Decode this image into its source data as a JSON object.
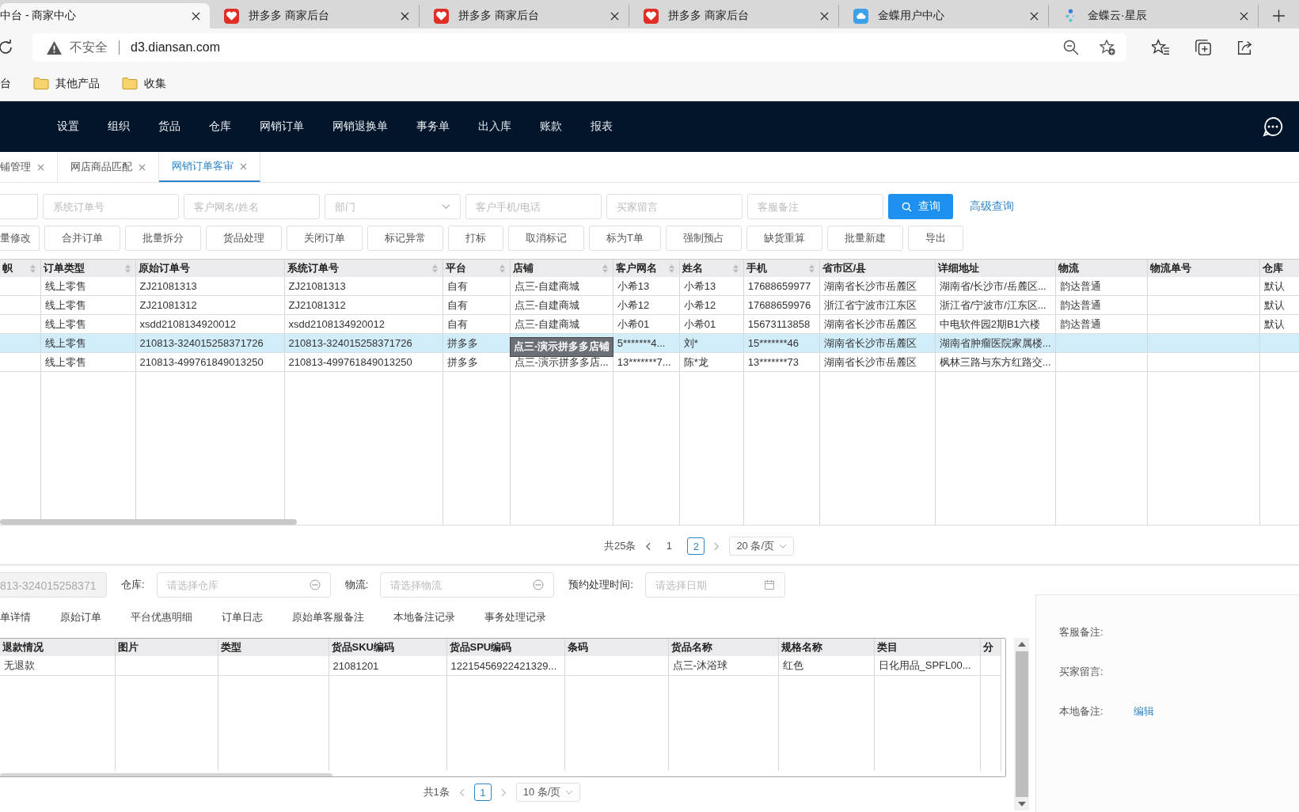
{
  "browser_tabs": [
    {
      "title": "中台 - 商家中心",
      "selected": true,
      "kind": "plain"
    },
    {
      "title": "拼多多 商家后台",
      "selected": false,
      "kind": "shop"
    },
    {
      "title": "拼多多 商家后台",
      "selected": false,
      "kind": "shop"
    },
    {
      "title": "拼多多 商家后台",
      "selected": false,
      "kind": "shop"
    },
    {
      "title": "金蝶用户中心",
      "selected": false,
      "kind": "cloud"
    },
    {
      "title": "金蝶云·星辰",
      "selected": false,
      "kind": "dots"
    }
  ],
  "address": {
    "security": "不安全",
    "url": "d3.diansan.com"
  },
  "bookmarks": [
    {
      "label": "台",
      "kind": "text"
    },
    {
      "label": "其他产品",
      "kind": "folder"
    },
    {
      "label": "收集",
      "kind": "folder"
    }
  ],
  "nav": [
    "设置",
    "组织",
    "货品",
    "仓库",
    "网销订单",
    "网销退换单",
    "事务单",
    "出入库",
    "账款",
    "报表"
  ],
  "page_tabs": [
    {
      "label": "铺管理",
      "selected": false
    },
    {
      "label": "网店商品匹配",
      "selected": false
    },
    {
      "label": "网销订单客审",
      "selected": true
    }
  ],
  "filters": [
    {
      "kind": "text"
    },
    {
      "kind": "text",
      "placeholder": "系统订单号"
    },
    {
      "kind": "text",
      "placeholder": "客户网名/姓名"
    },
    {
      "kind": "select",
      "placeholder": "部门"
    },
    {
      "kind": "text",
      "placeholder": "客户手机/电话"
    },
    {
      "kind": "text",
      "placeholder": "买家留言"
    },
    {
      "kind": "text",
      "placeholder": "客服备注"
    }
  ],
  "search_button": "查询",
  "advanced_link": "高级查询",
  "actions": [
    "量修改",
    "合并订单",
    "批量拆分",
    "货品处理",
    "关闭订单",
    "标记异常",
    "打标",
    "取消标记",
    "标为T单",
    "强制预占",
    "缺货重算",
    "批量新建",
    "导出"
  ],
  "orders": {
    "columns": [
      {
        "label": "帜",
        "sortable": true
      },
      {
        "label": "订单类型",
        "sortable": true
      },
      {
        "label": "原始订单号",
        "sortable": false
      },
      {
        "label": "系统订单号",
        "sortable": true
      },
      {
        "label": "平台",
        "sortable": true
      },
      {
        "label": "店铺",
        "sortable": true
      },
      {
        "label": "客户网名",
        "sortable": true
      },
      {
        "label": "姓名",
        "sortable": true
      },
      {
        "label": "手机",
        "sortable": true
      },
      {
        "label": "省市区/县",
        "sortable": false
      },
      {
        "label": "详细地址",
        "sortable": false
      },
      {
        "label": "物流",
        "sortable": false
      },
      {
        "label": "物流单号",
        "sortable": false
      },
      {
        "label": "仓库"
      }
    ],
    "rows": [
      {
        "selected": false,
        "cells": [
          "",
          "线上零售",
          "ZJ21081313",
          "ZJ21081313",
          "自有",
          "点三-自建商城",
          "小希13",
          "小希13",
          "17688659977",
          "湖南省长沙市岳麓区",
          "湖南省/长沙市/岳麓区...",
          "韵达普通",
          "",
          "默认"
        ]
      },
      {
        "selected": false,
        "cells": [
          "",
          "线上零售",
          "ZJ21081312",
          "ZJ21081312",
          "自有",
          "点三-自建商城",
          "小希12",
          "小希12",
          "17688659976",
          "浙江省宁波市江东区",
          "浙江省/宁波市/江东区...",
          "韵达普通",
          "",
          "默认"
        ]
      },
      {
        "selected": false,
        "cells": [
          "",
          "线上零售",
          "xsdd2108134920012",
          "xsdd2108134920012",
          "自有",
          "点三-自建商城",
          "小希01",
          "小希01",
          "15673113858",
          "湖南省长沙市岳麓区",
          "中电软件园2期B1六楼",
          "韵达普通",
          "",
          "默认"
        ]
      },
      {
        "selected": true,
        "cells": [
          "",
          "线上零售",
          "210813-324015258371726",
          "210813-324015258371726",
          "拼多多",
          "",
          "5*******4...",
          "刘*",
          "15*******46",
          "湖南省长沙市岳麓区",
          "湖南省肿瘤医院家属楼...",
          "",
          "",
          ""
        ]
      },
      {
        "selected": false,
        "cells": [
          "",
          "线上零售",
          "210813-499761849013250",
          "210813-499761849013250",
          "拼多多",
          "点三-演示拼多多店...",
          "13*******7...",
          "陈*龙",
          "13*******73",
          "湖南省长沙市岳麓区",
          "枫林三路与东方红路交...",
          "",
          "",
          ""
        ]
      }
    ],
    "tooltip": "点三-演示拼多多店铺"
  },
  "pagination": {
    "total": "共25条",
    "pages": [
      {
        "label": "1",
        "selected": false
      },
      {
        "label": "2",
        "selected": true
      }
    ],
    "page_size": "20 条/页"
  },
  "detail_form": {
    "order_no": "813-324015258371",
    "fields": [
      {
        "label": "仓库:",
        "placeholder": "请选择仓库",
        "kind": "picker"
      },
      {
        "label": "物流:",
        "placeholder": "请选择物流",
        "kind": "picker"
      },
      {
        "label": "预约处理时间:",
        "placeholder": "请选择日期",
        "kind": "date"
      }
    ]
  },
  "detail_tabs": [
    "单详情",
    "原始订单",
    "平台优惠明细",
    "订单日志",
    "原始单客服备注",
    "本地备注记录",
    "事务处理记录"
  ],
  "items": {
    "columns": [
      "退款情况",
      "图片",
      "类型",
      "货品SKU编码",
      "货品SPU编码",
      "条码",
      "货品名称",
      "规格名称",
      "类目",
      "分"
    ],
    "rows": [
      [
        "无退款",
        "",
        "",
        "21081201",
        "12215456922421329...",
        "",
        "点三-沐浴球",
        "红色",
        "日化用品_SPFL00...",
        ""
      ]
    ]
  },
  "items_pagination": {
    "total": "共1条",
    "pages": [
      {
        "label": "1",
        "selected": true
      }
    ],
    "page_size": "10 条/页"
  },
  "notes": [
    {
      "label": "客服备注:"
    },
    {
      "label": "买家留言:"
    },
    {
      "label": "本地备注:",
      "link": "编辑"
    }
  ]
}
